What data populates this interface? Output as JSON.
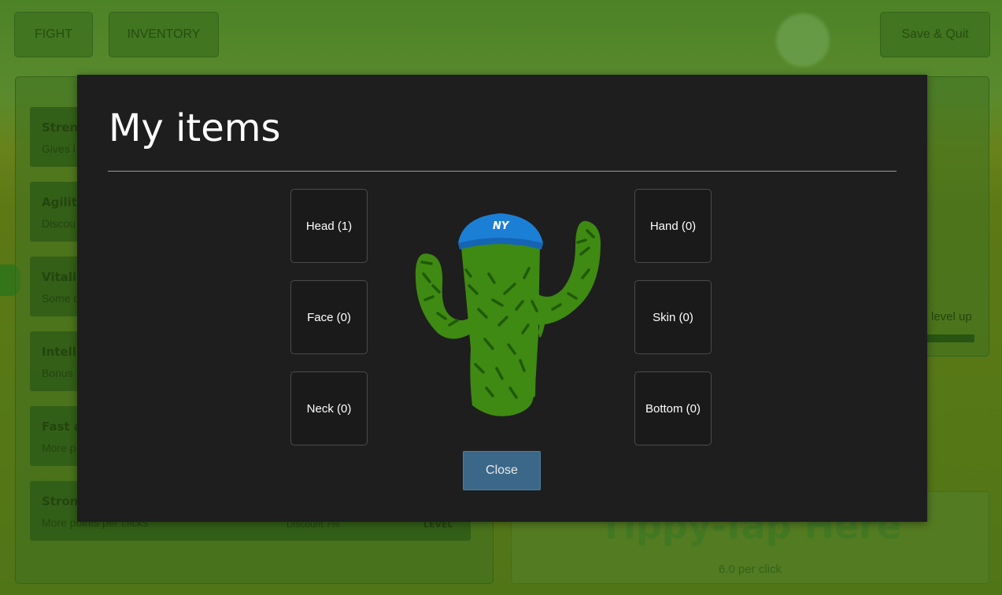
{
  "topbar": {
    "fight_label": "FIGHT",
    "inventory_label": "INVENTORY",
    "save_quit_label": "Save & Quit"
  },
  "stats": [
    {
      "name": "Stren",
      "desc": "Gives l"
    },
    {
      "name": "Agility",
      "desc": "Discou"
    },
    {
      "name": "Vitali",
      "desc": "Some o"
    },
    {
      "name": "Intell",
      "desc": "Bonus"
    },
    {
      "name": "Fast a",
      "desc": "More p"
    },
    {
      "name": "Stron",
      "desc": "More points per clicks",
      "extra": "Discount 7%",
      "level": "LEVEL"
    }
  ],
  "progress": {
    "label": "level up"
  },
  "tap": {
    "title": "Tippy-Tap Here",
    "subtitle": "6.0 per click"
  },
  "modal": {
    "title": "My items",
    "slots": {
      "head": "Head (1)",
      "face": "Face (0)",
      "neck": "Neck (0)",
      "hand": "Hand (0)",
      "skin": "Skin (0)",
      "bottom": "Bottom (0)"
    },
    "character": {
      "hat_logo": "NY"
    },
    "close_label": "Close"
  },
  "colors": {
    "modal_bg": "#1e1e1e",
    "close_button": "#3b6889",
    "cactus_green": "#3f8a12",
    "cactus_spine": "#1f5a0a",
    "cap_blue": "#1c7fd6"
  }
}
